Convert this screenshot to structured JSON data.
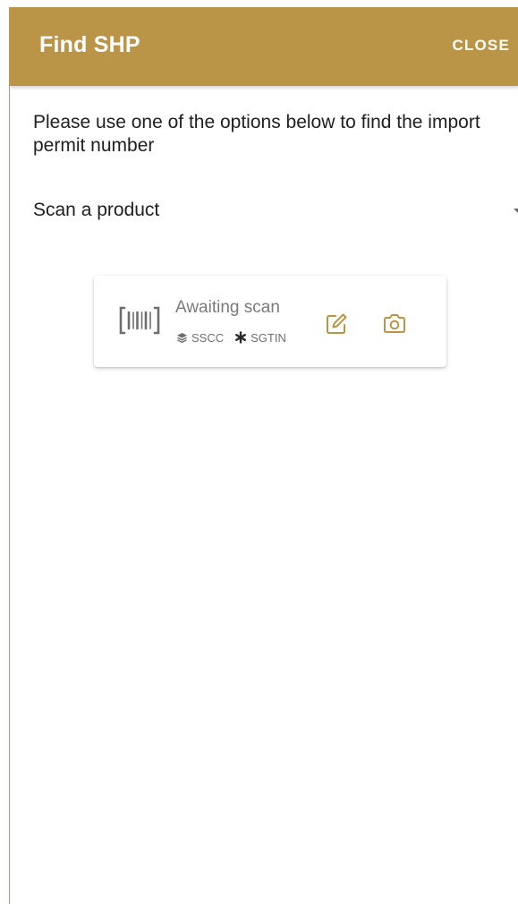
{
  "header": {
    "title": "Find SHP",
    "close_label": "CLOSE"
  },
  "instruction": "Please use one of the options below to find the import permit number",
  "lookup_method": {
    "selected": "Scan a product"
  },
  "scanner": {
    "status": "Awaiting scan",
    "code_types": [
      {
        "label": "SSCC",
        "icon": "layers-icon"
      },
      {
        "label": "SGTIN",
        "icon": "asterisk-icon"
      }
    ],
    "actions": [
      {
        "icon": "edit-icon"
      },
      {
        "icon": "camera-icon"
      }
    ]
  },
  "colors": {
    "brand": "#bb9547",
    "text": "#202020",
    "muted": "#7a7a7a"
  }
}
